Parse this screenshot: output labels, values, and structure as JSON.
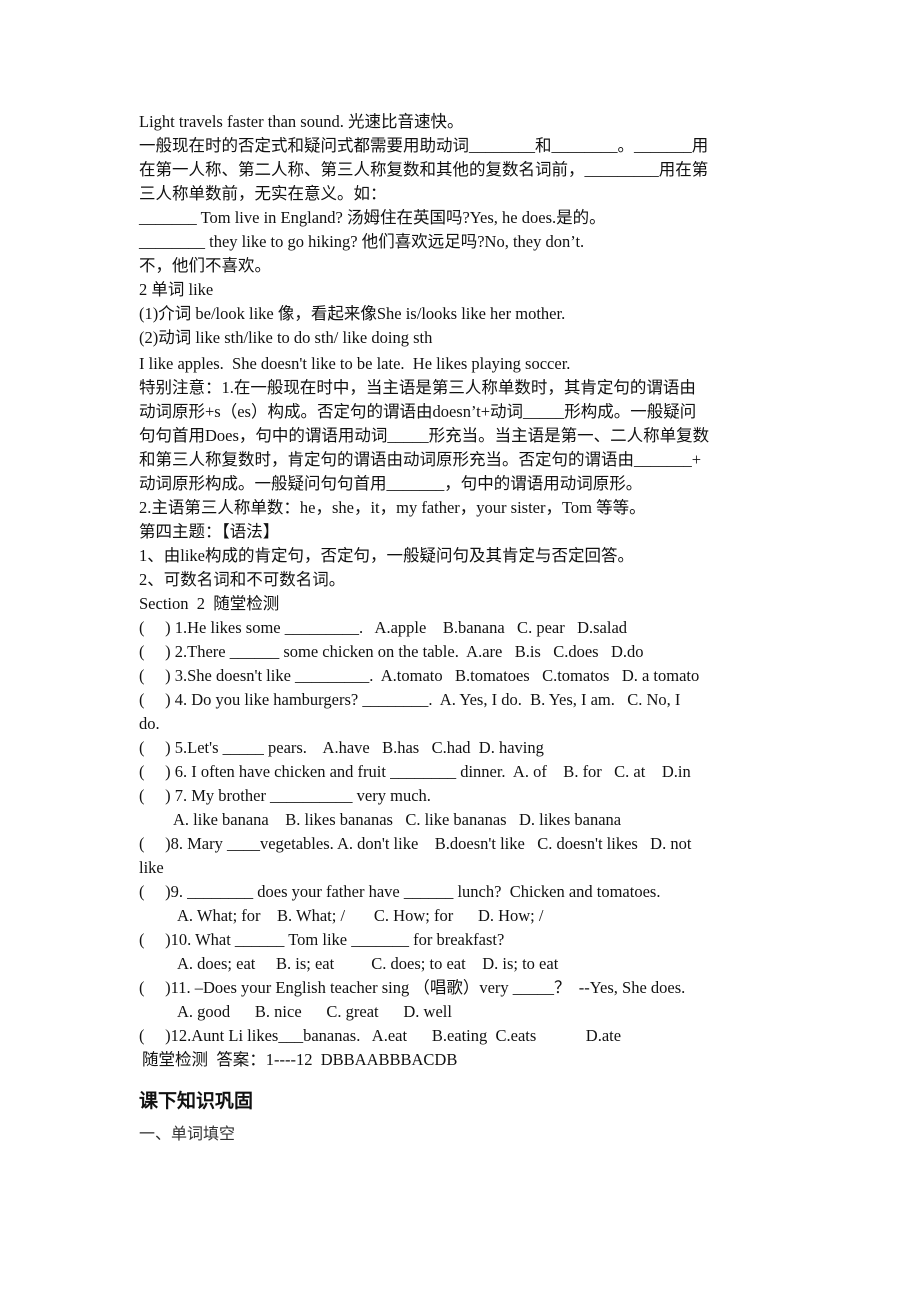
{
  "intro": {
    "line1": "Light travels faster than sound. 光速比音速快。",
    "line2": "一般现在时的否定式和疑问式都需要用助动词________和________。_______用",
    "line3": "在第一人称、第二人称、第三人称复数和其他的复数名词前，_________用在第",
    "line4": "三人称单数前，无实在意义。如：",
    "line5": "_______ Tom live in England? 汤姆住在英国吗?Yes, he does.是的。",
    "line6": "________ they like to go hiking? 他们喜欢远足吗?No, they don’t.",
    "line7": "不，他们不喜欢。"
  },
  "like_section": {
    "title": "2 单词 like",
    "item1": "(1)介词 be/look like 像，看起来像She is/looks like her mother.",
    "item2": "(2)动词 like sth/like to do sth/ like doing sth",
    "examples": "I like apples.  She doesn't like to be late.  He likes playing soccer."
  },
  "notes": {
    "line1": "特别注意：1.在一般现在时中，当主语是第三人称单数时，其肯定句的谓语由",
    "line2": "动词原形+s（es）构成。否定句的谓语由doesn’t+动词_____形构成。一般疑问",
    "line3": "句句首用Does，句中的谓语用动词_____形充当。当主语是第一、二人称单复数",
    "line4": "和第三人称复数时，肯定句的谓语由动词原形充当。否定句的谓语由_______+",
    "line5": "动词原形构成。一般疑问句句首用_______，句中的谓语用动词原形。",
    "line6": "2.主语第三人称单数：he，she，it，my father，your sister，Tom 等等。"
  },
  "topic4": {
    "title": "第四主题：【语法】",
    "point1": "1、由like构成的肯定句，否定句，一般疑问句及其肯定与否定回答。",
    "point2": "2、可数名词和不可数名词。"
  },
  "section2": {
    "title": "Section  2  随堂检测",
    "questions": [
      {
        "text": "(     ) 1.He likes some _________.   A.apple    B.banana   C. pear   D.salad"
      },
      {
        "text": "(     ) 2.There ______ some chicken on the table.  A.are   B.is   C.does   D.do"
      },
      {
        "text": "(     ) 3.She doesn't like _________.  A.tomato   B.tomatoes   C.tomatos   D. a tomato"
      },
      {
        "text": "(     ) 4. Do you like hamburgers? ________.  A. Yes, I do.  B. Yes, I am.   C. No, I",
        "cont": "do."
      },
      {
        "text": "(     ) 5.Let's _____ pears.    A.have   B.has   C.had  D. having"
      },
      {
        "text": "(     ) 6. I often have chicken and fruit ________ dinner.  A. of    B. for   C. at    D.in"
      },
      {
        "text": "(     ) 7. My brother __________ very much.",
        "options": "A. like banana    B. likes bananas   C. like bananas   D. likes banana"
      },
      {
        "text": "(     )8. Mary ____vegetables. A. don't like    B.doesn't like   C. doesn't likes   D. not",
        "cont": "like"
      },
      {
        "text": "(     )9. ________ does your father have ______ lunch?  Chicken and tomatoes.",
        "options": "A. What; for    B. What; /       C. How; for      D. How; /"
      },
      {
        "text": "(     )10. What ______ Tom like _______ for breakfast?",
        "options": "A. does; eat     B. is; eat         C. does; to eat    D. is; to eat"
      },
      {
        "text": "(     )11. –Does your English teacher sing （唱歌）very _____？  --Yes, She does.",
        "options": "A. good      B. nice      C. great      D. well"
      },
      {
        "text": "(     )12.Aunt Li likes___bananas.   A.eat      B.eating  C.eats            D.ate"
      }
    ],
    "answer_key": "随堂检测  答案：1----12  DBBAABBBACDB"
  },
  "after_class": {
    "title": "课下知识巩固",
    "subtitle": "一、单词填空"
  }
}
